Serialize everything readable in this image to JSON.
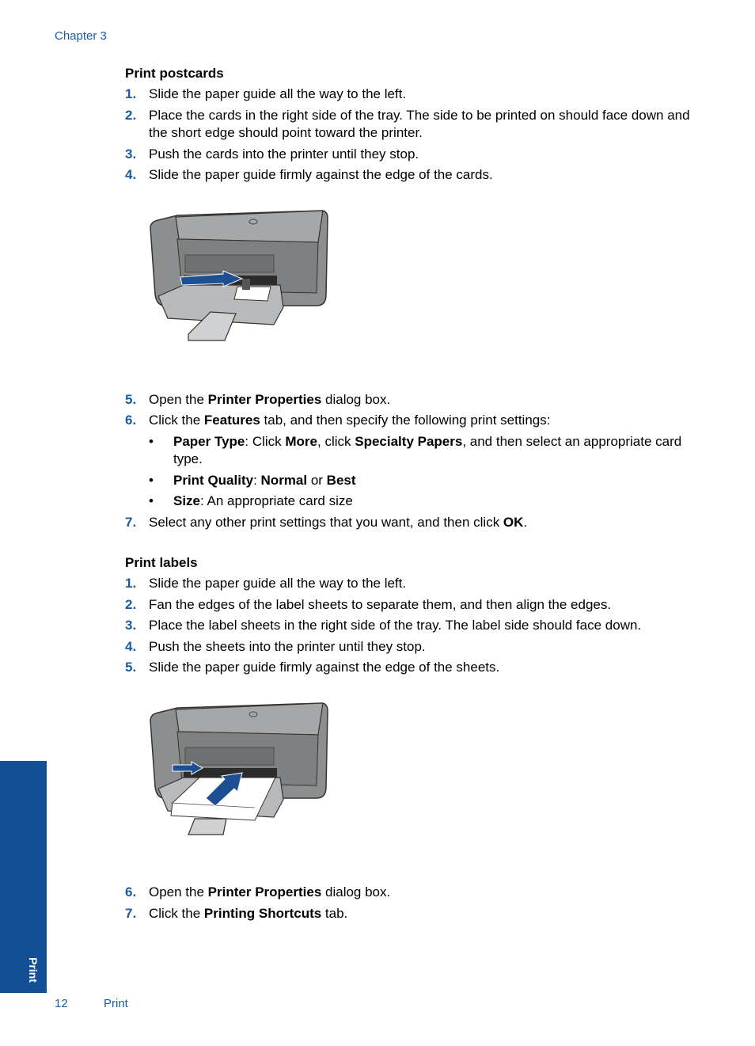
{
  "header": {
    "chapter": "Chapter 3"
  },
  "sections": [
    {
      "title": "Print postcards",
      "steps_before_figure": [
        {
          "num": "1.",
          "text": "Slide the paper guide all the way to the left."
        },
        {
          "num": "2.",
          "text": "Place the cards in the right side of the tray. The side to be printed on should face down and the short edge should point toward the printer."
        },
        {
          "num": "3.",
          "text": "Push the cards into the printer until they stop."
        },
        {
          "num": "4.",
          "text": "Slide the paper guide firmly against the edge of the cards."
        }
      ],
      "figure": {
        "description": "Printer illustration: loading cards with paper guide slid right",
        "icon": "printer-loading-cards-illustration"
      },
      "steps_after_figure": [
        {
          "num": "5.",
          "parts": [
            "Open the ",
            "Printer Properties",
            " dialog box."
          ]
        },
        {
          "num": "6.",
          "parts": [
            "Click the ",
            "Features",
            " tab, and then specify the following print settings:"
          ]
        },
        {
          "num": "7.",
          "parts": [
            "Select any other print settings that you want, and then click ",
            "OK",
            "."
          ]
        }
      ],
      "bullets": [
        {
          "parts": [
            "Paper Type",
            ": Click ",
            "More",
            ", click ",
            "Specialty Papers",
            ", and then select an appropriate card type."
          ]
        },
        {
          "parts": [
            "Print Quality",
            ": ",
            "Normal",
            " or ",
            "Best"
          ]
        },
        {
          "parts": [
            "Size",
            ": An appropriate card size"
          ]
        }
      ]
    },
    {
      "title": "Print labels",
      "steps_before_figure": [
        {
          "num": "1.",
          "text": "Slide the paper guide all the way to the left."
        },
        {
          "num": "2.",
          "text": "Fan the edges of the label sheets to separate them, and then align the edges."
        },
        {
          "num": "3.",
          "text": "Place the label sheets in the right side of the tray. The label side should face down."
        },
        {
          "num": "4.",
          "text": "Push the sheets into the printer until they stop."
        },
        {
          "num": "5.",
          "text": "Slide the paper guide firmly against the edge of the sheets."
        }
      ],
      "figure": {
        "description": "Printer illustration: loading label sheets with paper guide and push arrow",
        "icon": "printer-loading-labels-illustration"
      },
      "steps_after_figure": [
        {
          "num": "6.",
          "parts": [
            "Open the ",
            "Printer Properties",
            " dialog box."
          ]
        },
        {
          "num": "7.",
          "parts": [
            "Click the ",
            "Printing Shortcuts",
            " tab."
          ]
        }
      ]
    }
  ],
  "side_tab": {
    "label": "Print"
  },
  "footer": {
    "page_number": "12",
    "section": "Print"
  },
  "colors": {
    "accent": "#1a5ba6",
    "tab": "#124f94",
    "printer_gray": "#8c8e90",
    "arrow_blue": "#1d4f91"
  }
}
